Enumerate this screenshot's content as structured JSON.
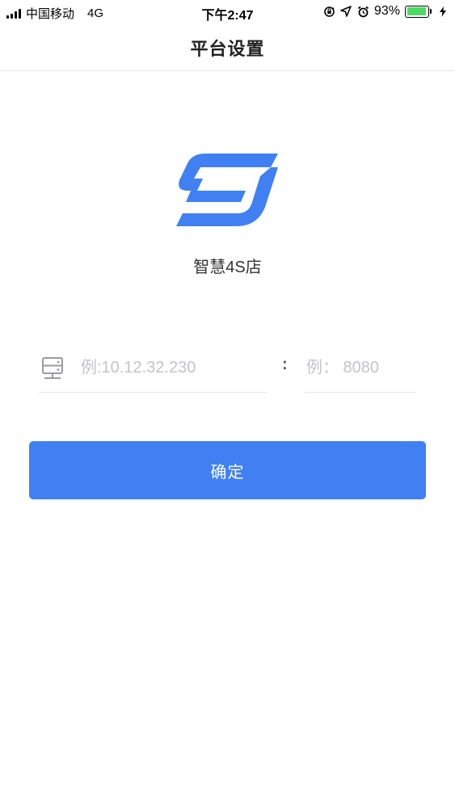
{
  "status_bar": {
    "carrier": "中国移动",
    "network": "4G",
    "time": "下午2:47",
    "battery_percent": "93%",
    "battery_level": 0.93,
    "icons": [
      "signal-icon",
      "orientation-lock-icon",
      "location-icon",
      "alarm-icon",
      "battery-icon",
      "charging-icon"
    ]
  },
  "nav": {
    "title": "平台设置"
  },
  "app": {
    "name": "智慧4S店",
    "logo": "app-logo-s",
    "brand_color": "#4080F3"
  },
  "form": {
    "ip_placeholder": "例:10.12.32.230",
    "ip_value": "",
    "separator": ":",
    "port_placeholder": "例： 8080",
    "port_value": "",
    "ip_icon": "server-icon"
  },
  "actions": {
    "confirm_label": "确定"
  }
}
